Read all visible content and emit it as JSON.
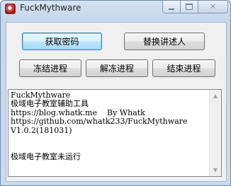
{
  "window": {
    "title": "FuckMythware",
    "icons": {
      "app": "app-icon",
      "minimize": "minimize-icon",
      "maximize": "maximize-icon",
      "close": "close-icon"
    },
    "close_glyph": "✕"
  },
  "buttons": {
    "get_password": "获取密码",
    "replace_narrator": "替换讲述人",
    "freeze_process": "冻结进程",
    "unfreeze_process": "解冻进程",
    "end_process": "结束进程"
  },
  "output": {
    "lines": [
      "FuckMythware",
      "极域电子教室辅助工具",
      "https://blog.whatk.me    By Whatk",
      "https://github.com/whatk233/FuckMythware",
      "V1.0.2(181031)",
      "",
      "",
      "极域电子教室未运行"
    ]
  },
  "scrollbar": {
    "up_glyph": "▲",
    "down_glyph": "▼"
  }
}
